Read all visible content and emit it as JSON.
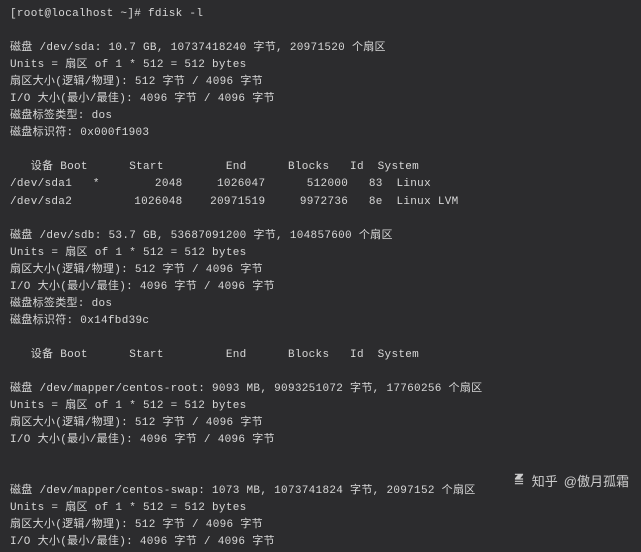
{
  "prompt": {
    "line": "[root@localhost ~]# fdisk -l"
  },
  "disk_sda": {
    "header": "磁盘 /dev/sda: 10.7 GB, 10737418240 字节, 20971520 个扇区",
    "units": "Units = 扇区 of 1 * 512 = 512 bytes",
    "sector_size": "扇区大小(逻辑/物理): 512 字节 / 4096 字节",
    "io_size": "I/O 大小(最小/最佳): 4096 字节 / 4096 字节",
    "label_type": "磁盘标签类型: dos",
    "identifier": "磁盘标识符: 0x000f1903"
  },
  "partition_table_sda": {
    "header": "   设备 Boot      Start         End      Blocks   Id  System",
    "rows": [
      "/dev/sda1   *        2048     1026047      512000   83  Linux",
      "/dev/sda2         1026048    20971519     9972736   8e  Linux LVM"
    ]
  },
  "disk_sdb": {
    "header": "磁盘 /dev/sdb: 53.7 GB, 53687091200 字节, 104857600 个扇区",
    "units": "Units = 扇区 of 1 * 512 = 512 bytes",
    "sector_size": "扇区大小(逻辑/物理): 512 字节 / 4096 字节",
    "io_size": "I/O 大小(最小/最佳): 4096 字节 / 4096 字节",
    "label_type": "磁盘标签类型: dos",
    "identifier": "磁盘标识符: 0x14fbd39c"
  },
  "partition_table_sdb": {
    "header": "   设备 Boot      Start         End      Blocks   Id  System"
  },
  "disk_centos_root": {
    "header": "磁盘 /dev/mapper/centos-root: 9093 MB, 9093251072 字节, 17760256 个扇区",
    "units": "Units = 扇区 of 1 * 512 = 512 bytes",
    "sector_size": "扇区大小(逻辑/物理): 512 字节 / 4096 字节",
    "io_size": "I/O 大小(最小/最佳): 4096 字节 / 4096 字节"
  },
  "disk_centos_swap": {
    "header": "磁盘 /dev/mapper/centos-swap: 1073 MB, 1073741824 字节, 2097152 个扇区",
    "units": "Units = 扇区 of 1 * 512 = 512 bytes",
    "sector_size": "扇区大小(逻辑/物理): 512 字节 / 4096 字节",
    "io_size": "I/O 大小(最小/最佳): 4096 字节 / 4096 字节"
  },
  "watermark": {
    "source": "知乎",
    "author": "@傲月孤霜"
  }
}
